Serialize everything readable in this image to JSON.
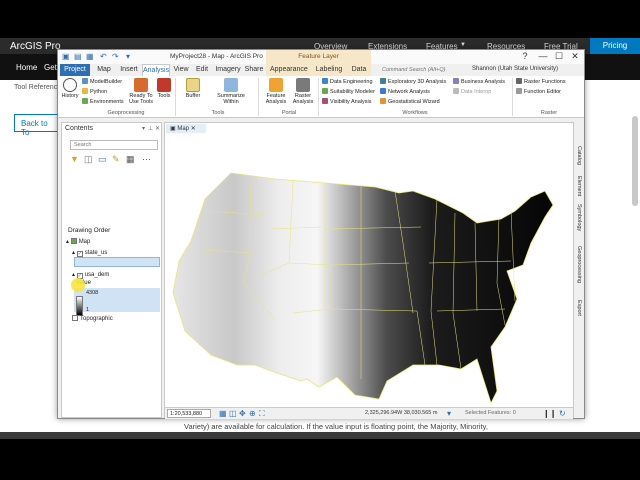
{
  "web": {
    "brand": "ArcGIS Pro",
    "nav": [
      "Overview",
      "Extensions",
      "Features",
      "Resources",
      "Free Trial"
    ],
    "features_caret": "▼",
    "pricing": "Pricing",
    "subnav": [
      "Home",
      "Get"
    ],
    "tool_ref": "Tool Reference",
    "back_btn": "Back to To",
    "footer_text": "Variety) are available for calculation. If the value input is floating point, the Majority, Minority,"
  },
  "app": {
    "window_title": "MyProject28 - Map - ArcGIS Pro",
    "context_tab": "Feature Layer",
    "tabs": [
      "Project",
      "Map",
      "Insert",
      "Analysis",
      "View",
      "Edit",
      "Imagery",
      "Share",
      "Appearance",
      "Labeling",
      "Data"
    ],
    "active_tab": "Analysis",
    "command_search": "Command Search (Alt+Q)",
    "user": "Shannon (Utah State University)",
    "window_controls": [
      "?",
      "—",
      "☐",
      "✕"
    ],
    "ribbon": {
      "history": "History",
      "modelbuilder": "ModelBuilder",
      "python": "Python",
      "environments": "Environments",
      "ready_tools": "Ready To Use Tools",
      "tools": "Tools",
      "buffer": "Buffer",
      "summarize": "Summarize Within",
      "feature_analysis": "Feature Analysis",
      "raster_analysis": "Raster Analysis",
      "data_engineering": "Data Engineering",
      "suitability": "Suitability Modeler",
      "visibility": "Visibility Analysis",
      "exploratory": "Exploratory 3D Analysis",
      "network": "Network Analysis",
      "geostatistical": "Geostatistical Wizard",
      "business": "Business Analysis",
      "data_interop": "Data Interop",
      "raster_functions": "Raster Functions",
      "function_editor": "Function Editor",
      "groups": [
        "Geoprocessing",
        "Tools",
        "Portal",
        "Workflows",
        "Raster"
      ]
    },
    "contents": {
      "title": "Contents",
      "search_placeholder": "Search",
      "drawing_order": "Drawing Order",
      "map": "Map",
      "state_layer": "state_us",
      "dem_layer": "usa_dem",
      "value_label": "Value",
      "value_high": "4308",
      "value_low": "1",
      "topographic": "Topographic"
    },
    "map": {
      "tab": "Map",
      "scale": "1:20,533,880",
      "coords": "2,325,296.94W 38,030.565 m",
      "selected_features": "Selected Features: 0"
    },
    "side_tabs": [
      "Catalog",
      "Element",
      "Symbology",
      "Geoprocessing",
      "Export"
    ]
  }
}
